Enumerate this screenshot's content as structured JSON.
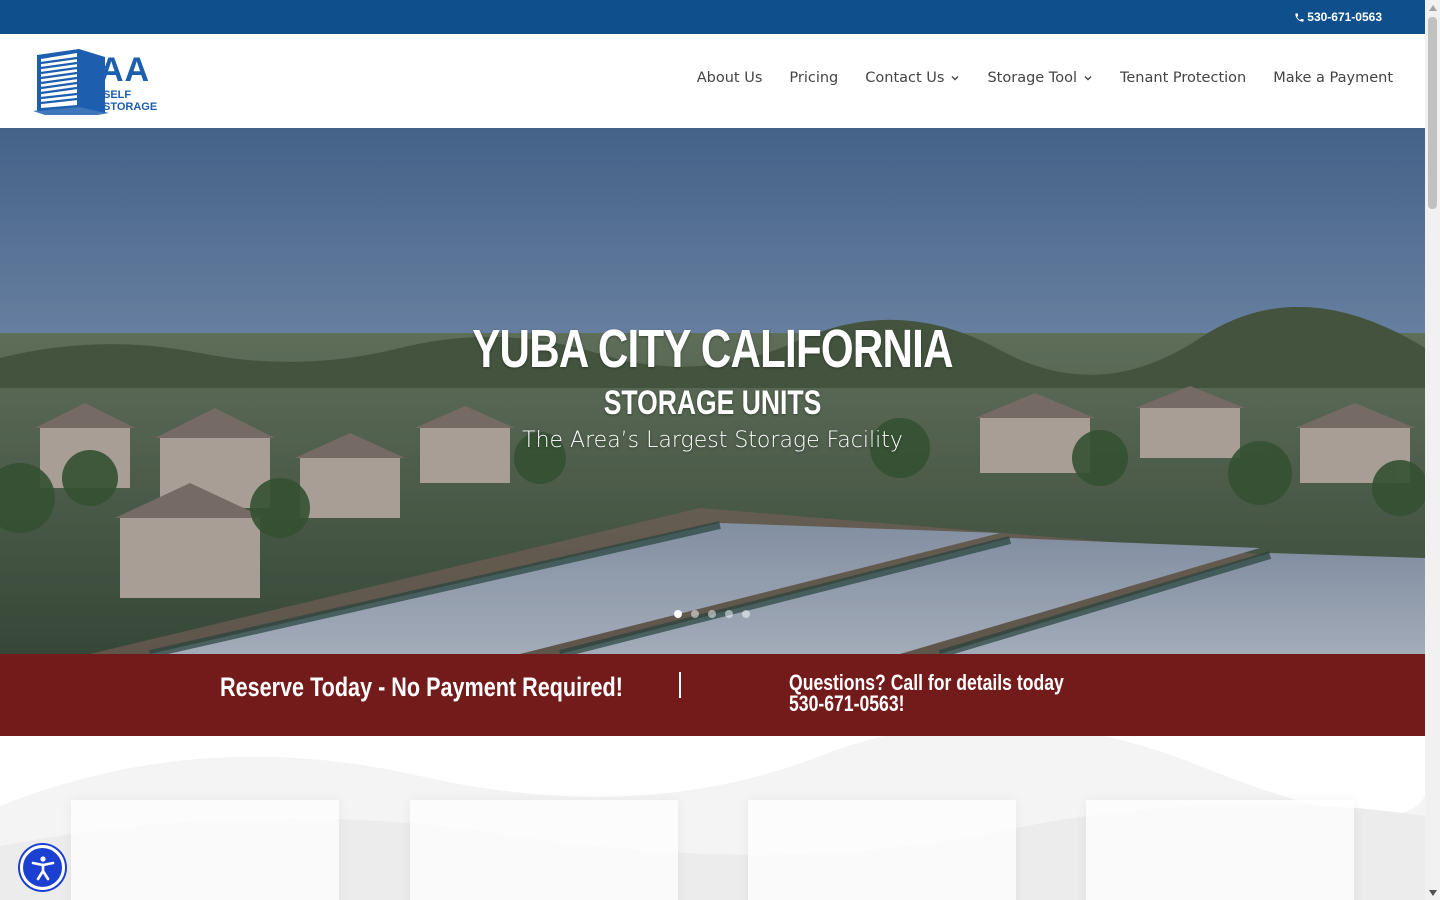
{
  "topbar": {
    "phone": "530-671-0563",
    "phone_icon": "phone-icon"
  },
  "logo": {
    "line1": "AA",
    "line2": "SELF STORAGE"
  },
  "nav": {
    "items": [
      {
        "label": "About Us",
        "dropdown": false
      },
      {
        "label": "Pricing",
        "dropdown": false
      },
      {
        "label": "Contact Us",
        "dropdown": true
      },
      {
        "label": "Storage Tool",
        "dropdown": true
      },
      {
        "label": "Tenant Protection",
        "dropdown": false
      },
      {
        "label": "Make a Payment",
        "dropdown": false
      }
    ]
  },
  "hero": {
    "title": "YUBA CITY CALIFORNIA",
    "subtitle": "STORAGE UNITS",
    "tagline": "The Area’s Largest Storage Facility",
    "slides": 5,
    "active_slide": 1
  },
  "banner": {
    "left": "Reserve Today - No Payment Required!",
    "right_line1": "Questions? Call for details today",
    "right_line2": "530-671-0563!"
  },
  "colors": {
    "topbar": "#0f4f8c",
    "banner": "#731a1a",
    "accessibility": "#1a3fd1"
  },
  "accessibility": {
    "icon": "accessibility-icon"
  }
}
